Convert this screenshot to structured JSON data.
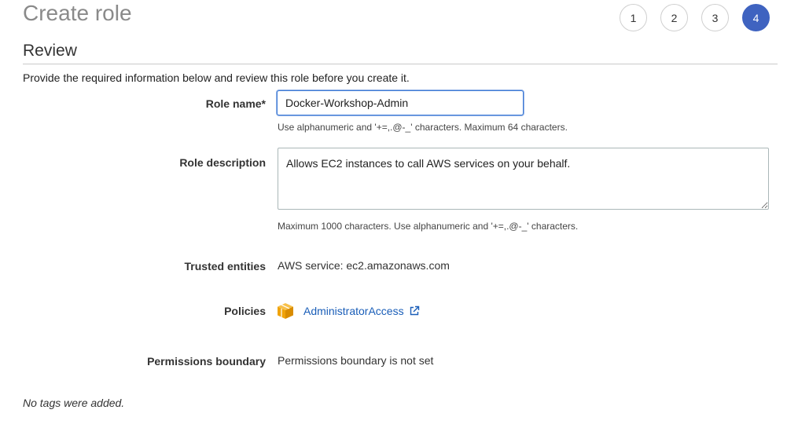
{
  "page": {
    "title": "Create role"
  },
  "stepper": {
    "steps": [
      {
        "label": "1",
        "active": false
      },
      {
        "label": "2",
        "active": false
      },
      {
        "label": "3",
        "active": false
      },
      {
        "label": "4",
        "active": true
      }
    ],
    "accent_color": "#3f63c0"
  },
  "review": {
    "title": "Review",
    "intro": "Provide the required information below and review this role before you create it."
  },
  "role_name": {
    "label": "Role name*",
    "value": "Docker-Workshop-Admin",
    "hint": "Use alphanumeric and '+=,.@-_' characters. Maximum 64 characters."
  },
  "role_description": {
    "label": "Role description",
    "value": "Allows EC2 instances to call AWS services on your behalf.",
    "hint": "Maximum 1000 characters. Use alphanumeric and '+=,.@-_' characters."
  },
  "trusted_entities": {
    "label": "Trusted entities",
    "value": "AWS service: ec2.amazonaws.com"
  },
  "policies": {
    "label": "Policies",
    "items": [
      {
        "name": "AdministratorAccess",
        "icon": "policy-cube-icon",
        "link_icon": "external-link-icon"
      }
    ],
    "link_color": "#1a5eb8",
    "icon_color": "#f0a30a"
  },
  "permissions_boundary": {
    "label": "Permissions boundary",
    "value": "Permissions boundary is not set"
  },
  "tags": {
    "message": "No tags were added."
  }
}
